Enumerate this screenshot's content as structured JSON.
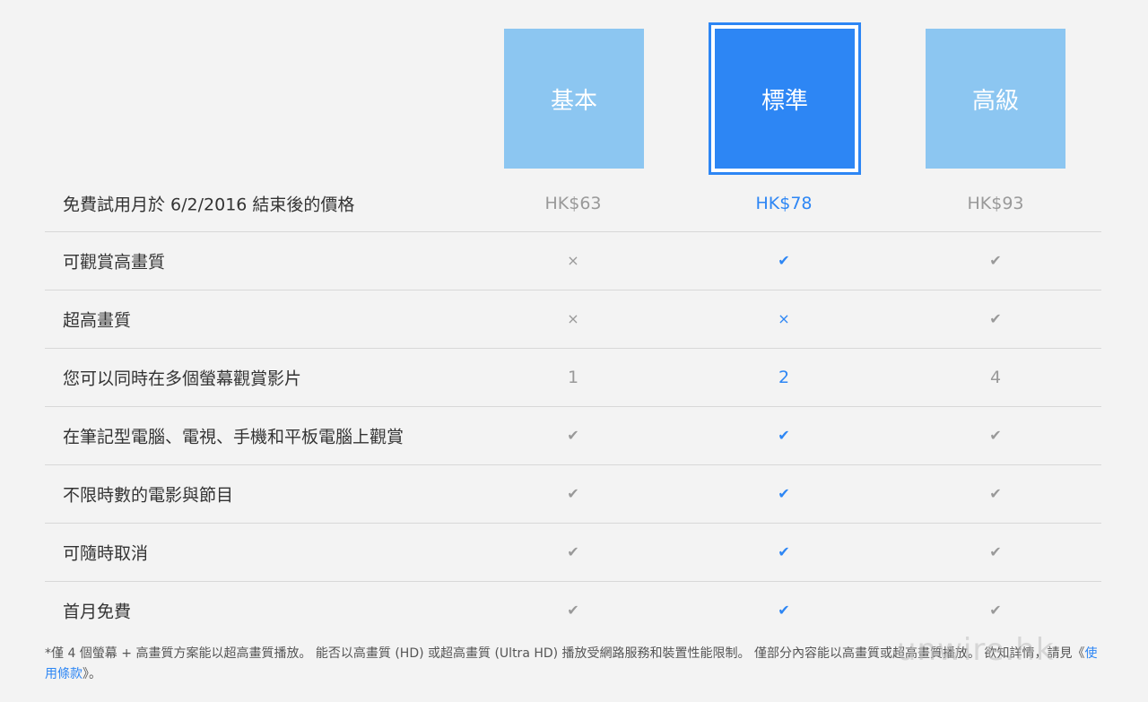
{
  "plans": {
    "basic": "基本",
    "standard": "標準",
    "premium": "高級"
  },
  "rows": [
    {
      "label": "免費試用月於 6/2/2016 結束後的價格",
      "basic": "HK$63",
      "standard": "HK$78",
      "premium": "HK$93"
    },
    {
      "label": "可觀賞高畫質",
      "basic": "×",
      "standard": "✔",
      "premium": "✔"
    },
    {
      "label": "超高畫質",
      "basic": "×",
      "standard": "×",
      "premium": "✔"
    },
    {
      "label": "您可以同時在多個螢幕觀賞影片",
      "basic": "1",
      "standard": "2",
      "premium": "4"
    },
    {
      "label": "在筆記型電腦、電視、手機和平板電腦上觀賞",
      "basic": "✔",
      "standard": "✔",
      "premium": "✔"
    },
    {
      "label": "不限時數的電影與節目",
      "basic": "✔",
      "standard": "✔",
      "premium": "✔"
    },
    {
      "label": "可隨時取消",
      "basic": "✔",
      "standard": "✔",
      "premium": "✔"
    },
    {
      "label": "首月免費",
      "basic": "✔",
      "standard": "✔",
      "premium": "✔"
    }
  ],
  "footnote": {
    "text": "*僅 4 個螢幕 + 高畫質方案能以超高畫質播放。 能否以高畫質 (HD) 或超高畫質 (Ultra HD) 播放受網路服務和裝置性能限制。 僅部分內容能以高畫質或超高畫質播放。 欲知詳情，請見《",
    "link": "使用條款",
    "suffix": "》。"
  },
  "watermark": "unwire.hk",
  "colors": {
    "accent": "#2d86f4",
    "plan_light": "#8cc6f1",
    "muted": "#999999"
  }
}
